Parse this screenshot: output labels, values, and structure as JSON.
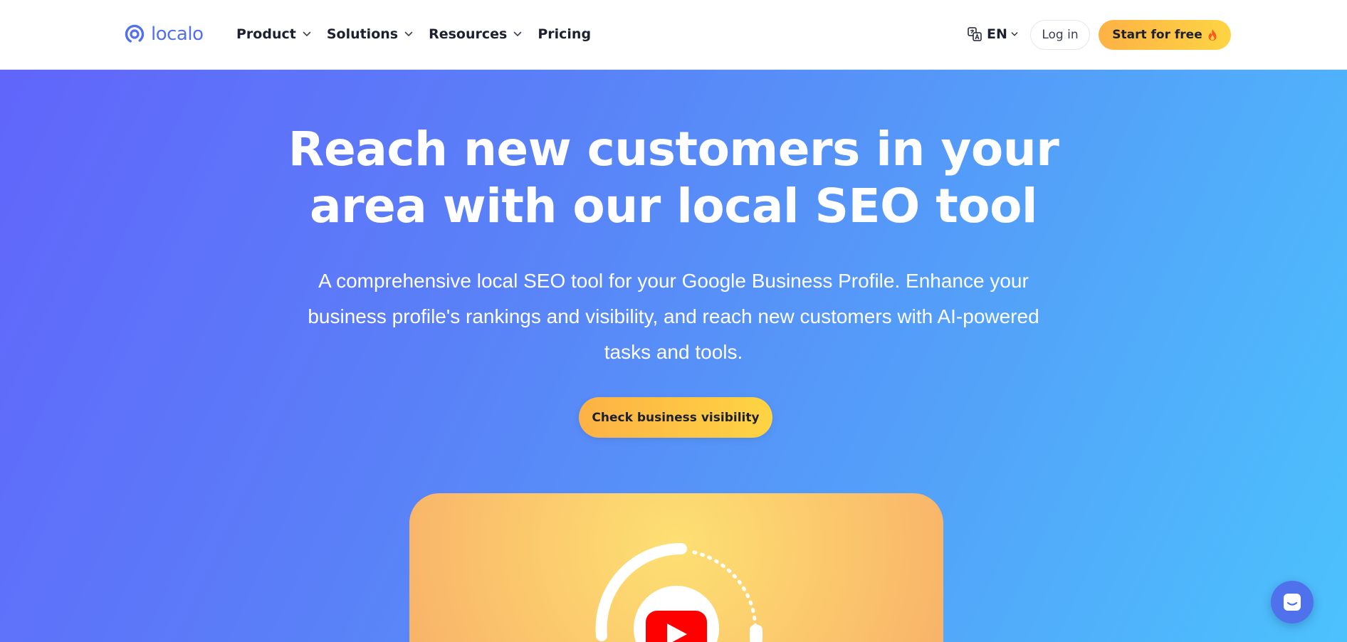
{
  "header": {
    "logo_text": "localo",
    "nav": [
      {
        "label": "Product",
        "has_dropdown": true
      },
      {
        "label": "Solutions",
        "has_dropdown": true
      },
      {
        "label": "Resources",
        "has_dropdown": true
      },
      {
        "label": "Pricing",
        "has_dropdown": false
      }
    ],
    "language": "EN",
    "login_label": "Log in",
    "start_label": "Start for free",
    "start_icon": "fire-icon"
  },
  "hero": {
    "headline_line1": "Reach new customers in your",
    "headline_line2": "area with our local SEO tool",
    "subtitle": "A comprehensive local SEO tool for your Google Business Profile. Enhance your business profile's rankings and visibility, and reach new customers with AI-powered tasks and tools.",
    "cta_label": "Check business visibility",
    "video_icon": "youtube-play-icon"
  },
  "chat": {
    "icon": "chat-bubble-icon"
  },
  "colors": {
    "brand": "#5270ee",
    "accent_yellow": "#fed443",
    "accent_orange": "#fdb245",
    "hero_start": "#6165fb",
    "hero_end": "#4cc2fd"
  }
}
